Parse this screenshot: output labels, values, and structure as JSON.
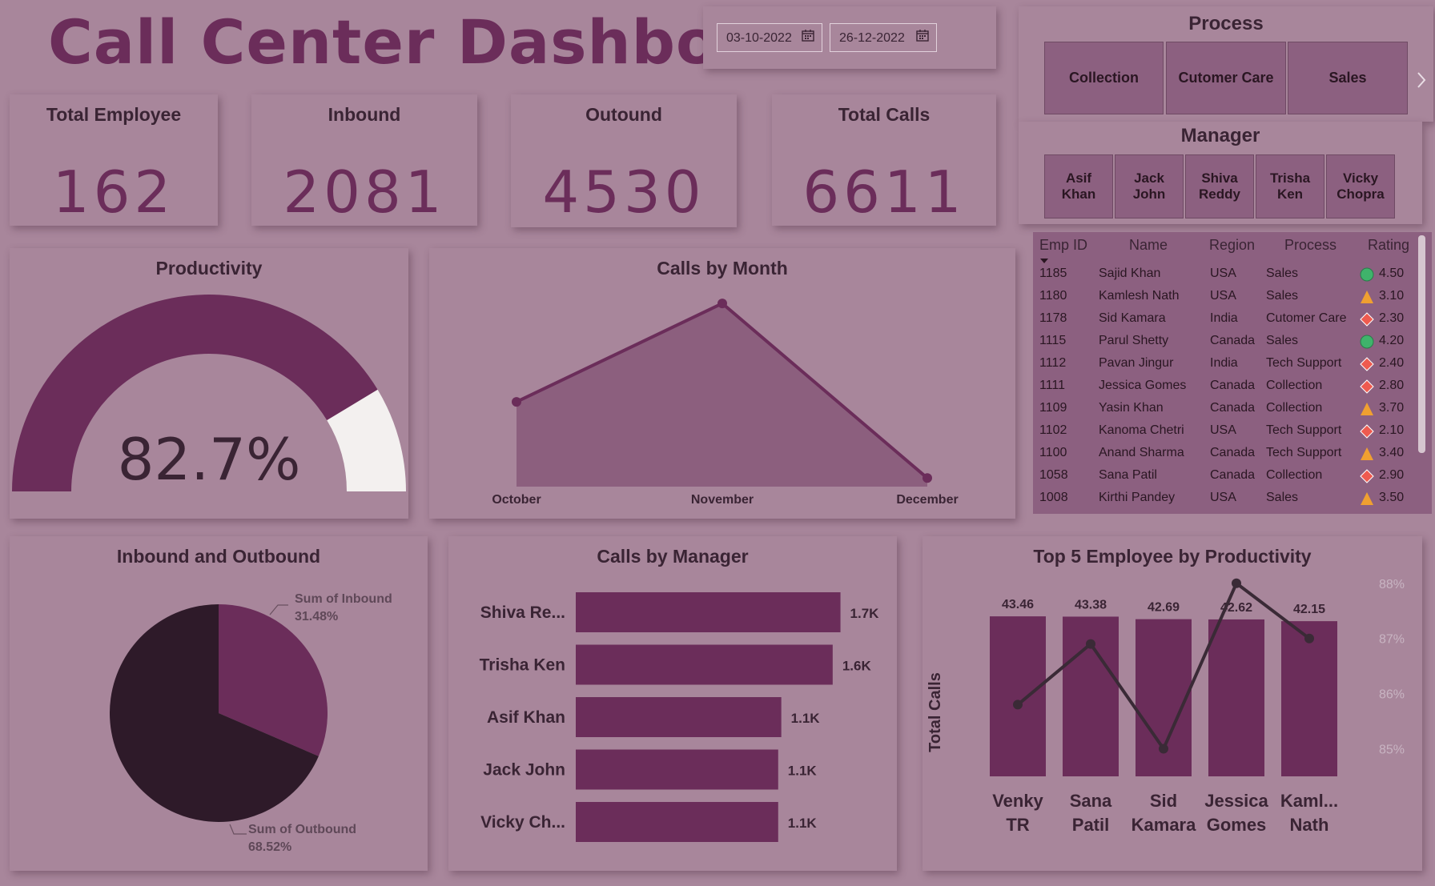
{
  "header": {
    "title": "Call Center Dashboard"
  },
  "date_range": {
    "start": "03-10-2022",
    "end": "26-12-2022"
  },
  "colors": {
    "background": "#a8869b",
    "accent": "#6b2d5a",
    "dark": "#2e1a29",
    "light": "#f3f0ef"
  },
  "kpis": [
    {
      "label": "Total Employee",
      "value": "162"
    },
    {
      "label": "Inbound",
      "value": "2081"
    },
    {
      "label": "Outound",
      "value": "4530"
    },
    {
      "label": "Total Calls",
      "value": "6611"
    }
  ],
  "process_slicer": {
    "title": "Process",
    "items": [
      "Collection",
      "Cutomer Care",
      "Sales"
    ],
    "next_icon": "chevron-right-icon"
  },
  "manager_slicer": {
    "title": "Manager",
    "items": [
      [
        "Asif",
        "Khan"
      ],
      [
        "Jack",
        "John"
      ],
      [
        "Shiva",
        "Reddy"
      ],
      [
        "Trisha",
        "Ken"
      ],
      [
        "Vicky",
        "Chopra"
      ]
    ]
  },
  "employee_table": {
    "columns": [
      "Emp ID",
      "Name",
      "Region",
      "Process",
      "Rating"
    ],
    "sort_icon": "sort-down-icon",
    "rows": [
      {
        "id": "1185",
        "name": "Sajid Khan",
        "region": "USA",
        "process": "Sales",
        "rating": "4.50",
        "icon": "circle"
      },
      {
        "id": "1180",
        "name": "Kamlesh Nath",
        "region": "USA",
        "process": "Sales",
        "rating": "3.10",
        "icon": "triangle"
      },
      {
        "id": "1178",
        "name": "Sid Kamara",
        "region": "India",
        "process": "Cutomer Care",
        "rating": "2.30",
        "icon": "diamond"
      },
      {
        "id": "1115",
        "name": "Parul Shetty",
        "region": "Canada",
        "process": "Sales",
        "rating": "4.20",
        "icon": "circle"
      },
      {
        "id": "1112",
        "name": "Pavan Jingur",
        "region": "India",
        "process": "Tech Support",
        "rating": "2.40",
        "icon": "diamond"
      },
      {
        "id": "1111",
        "name": "Jessica Gomes",
        "region": "Canada",
        "process": "Collection",
        "rating": "2.80",
        "icon": "diamond"
      },
      {
        "id": "1109",
        "name": "Yasin Khan",
        "region": "Canada",
        "process": "Collection",
        "rating": "3.70",
        "icon": "triangle"
      },
      {
        "id": "1102",
        "name": "Kanoma Chetri",
        "region": "USA",
        "process": "Tech Support",
        "rating": "2.10",
        "icon": "diamond"
      },
      {
        "id": "1100",
        "name": "Anand Sharma",
        "region": "Canada",
        "process": "Tech Support",
        "rating": "3.40",
        "icon": "triangle"
      },
      {
        "id": "1058",
        "name": "Sana Patil",
        "region": "Canada",
        "process": "Collection",
        "rating": "2.90",
        "icon": "diamond"
      },
      {
        "id": "1008",
        "name": "Kirthi Pandey",
        "region": "USA",
        "process": "Sales",
        "rating": "3.50",
        "icon": "triangle"
      }
    ]
  },
  "chart_data": [
    {
      "type": "gauge",
      "title": "Productivity",
      "value": 82.7,
      "max": 100,
      "label": "82.7%"
    },
    {
      "type": "area",
      "title": "Calls by Month",
      "categories": [
        "October",
        "November",
        "December"
      ],
      "values": [
        1990,
        3140,
        1100
      ],
      "ylim": [
        1000,
        3300
      ]
    },
    {
      "type": "pie",
      "title": "Inbound and Outbound",
      "slices": [
        {
          "label": "Sum of Inbound",
          "pct_label": "31.48%",
          "value": 31.48,
          "color": "#6b2d5a"
        },
        {
          "label": "Sum of Outbound",
          "pct_label": "68.52%",
          "value": 68.52,
          "color": "#2e1a29"
        }
      ]
    },
    {
      "type": "bar",
      "orientation": "horizontal",
      "title": "Calls by Manager",
      "categories": [
        "Shiva Re...",
        "Trisha Ken",
        "Asif Khan",
        "Jack John",
        "Vicky Ch..."
      ],
      "values": [
        1700,
        1650,
        1320,
        1300,
        1300
      ],
      "labels": [
        "1.7K",
        "1.6K",
        "1.1K",
        "1.1K",
        "1.1K"
      ],
      "xlim": [
        0,
        1800
      ]
    },
    {
      "type": "bar+line",
      "title": "Top 5 Employee by Productivity",
      "ylabel": "Total Calls",
      "categories": [
        [
          "Venky",
          "TR"
        ],
        [
          "Sana",
          "Patil"
        ],
        [
          "Sid",
          "Kamara"
        ],
        [
          "Jessica",
          "Gomes"
        ],
        [
          "Kaml...",
          "Nath"
        ]
      ],
      "values": [
        43.46,
        43.38,
        42.69,
        42.62,
        42.15
      ],
      "labels": [
        "43.46",
        "43.38",
        "42.69",
        "42.62",
        "42.15"
      ],
      "ylim": [
        0,
        50
      ],
      "line_values": [
        85.8,
        86.9,
        85.0,
        88.0,
        87.0
      ],
      "y2lim": [
        84.5,
        88.2
      ],
      "y2_ticks": [
        "88%",
        "87%",
        "86%",
        "85%"
      ],
      "y2_tick_values": [
        88,
        87,
        86,
        85
      ]
    }
  ]
}
